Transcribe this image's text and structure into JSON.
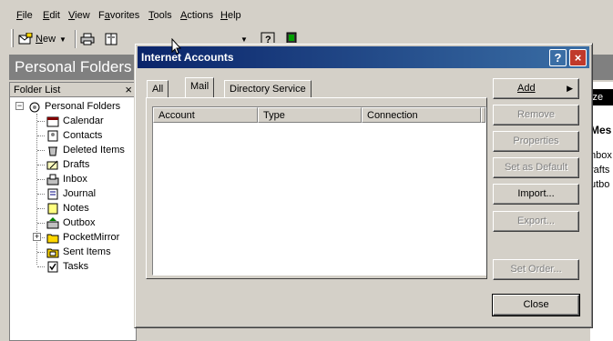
{
  "menubar": {
    "items": [
      "File",
      "Edit",
      "View",
      "Favorites",
      "Tools",
      "Actions",
      "Help"
    ]
  },
  "toolbar": {
    "new_label": "New",
    "new_icon": "new-mail-icon",
    "print_icon": "printer-icon",
    "address_icon": "address-book-icon",
    "help_icon": "help-icon",
    "pocketmirror_icon": "pocketmirror-icon"
  },
  "background": {
    "title": "Personal Folders",
    "folder_list_label": "Folder List",
    "folder_close": "×",
    "root": "Personal Folders",
    "folders": [
      "Calendar",
      "Contacts",
      "Deleted Items",
      "Drafts",
      "Inbox",
      "Journal",
      "Notes",
      "Outbox",
      "PocketMirror",
      "Sent Items",
      "Tasks"
    ],
    "right_partial": [
      "ize O",
      "Mes",
      "nbox",
      "rafts",
      "utbo"
    ]
  },
  "dialog": {
    "title": "Internet Accounts",
    "help_btn": "?",
    "close_btn": "×",
    "tabs": [
      "All",
      "Mail",
      "Directory Service"
    ],
    "active_tab": "Mail",
    "columns": [
      "Account",
      "Type",
      "Connection"
    ],
    "buttons": {
      "add": "Add",
      "remove": "Remove",
      "properties": "Properties",
      "set_default": "Set as Default",
      "import": "Import...",
      "export": "Export...",
      "set_order": "Set Order...",
      "close": "Close"
    }
  }
}
